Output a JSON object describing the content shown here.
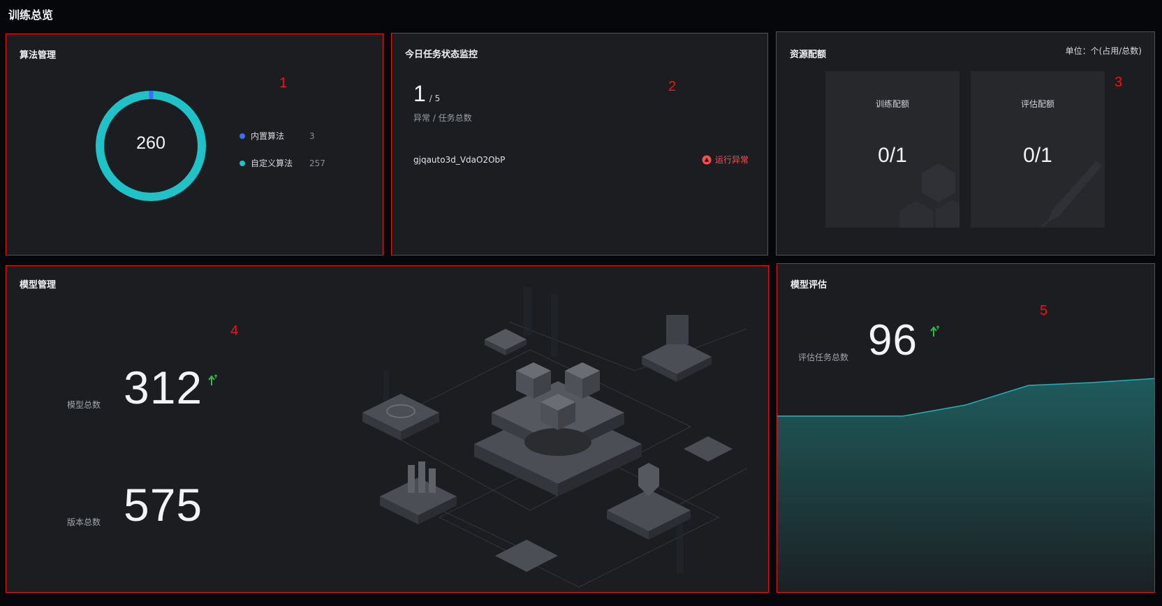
{
  "page": {
    "title": "训练总览"
  },
  "algorithms": {
    "title": "算法管理",
    "marker": "1",
    "total": "260",
    "items": [
      {
        "label": "内置算法",
        "value": "3",
        "color": "#3b6ef5"
      },
      {
        "label": "自定义算法",
        "value": "257",
        "color": "#1fc2c7"
      }
    ]
  },
  "tasks": {
    "title": "今日任务状态监控",
    "marker": "2",
    "abnormal_count": "1",
    "total_text": "/ 5",
    "caption": "异常 / 任务总数",
    "rows": [
      {
        "name": "gjqauto3d_VdaO2ObP",
        "status": "运行异常",
        "status_color": "#ff4d4f"
      }
    ]
  },
  "resources": {
    "title": "资源配额",
    "marker": "3",
    "unit": "单位：个(占用/总数)",
    "quotas": [
      {
        "label": "训练配额",
        "value": "0/1"
      },
      {
        "label": "评估配额",
        "value": "0/1"
      }
    ]
  },
  "models": {
    "title": "模型管理",
    "marker": "4",
    "model_total_label": "模型总数",
    "model_total": "312",
    "version_total_label": "版本总数",
    "version_total": "575",
    "trend_icon": "arrow-up-icon"
  },
  "evaluation": {
    "title": "模型评估",
    "marker": "5",
    "label": "评估任务总数",
    "value": "96",
    "trend_icon": "arrow-up-icon",
    "accent": "#1fb3b8"
  }
}
